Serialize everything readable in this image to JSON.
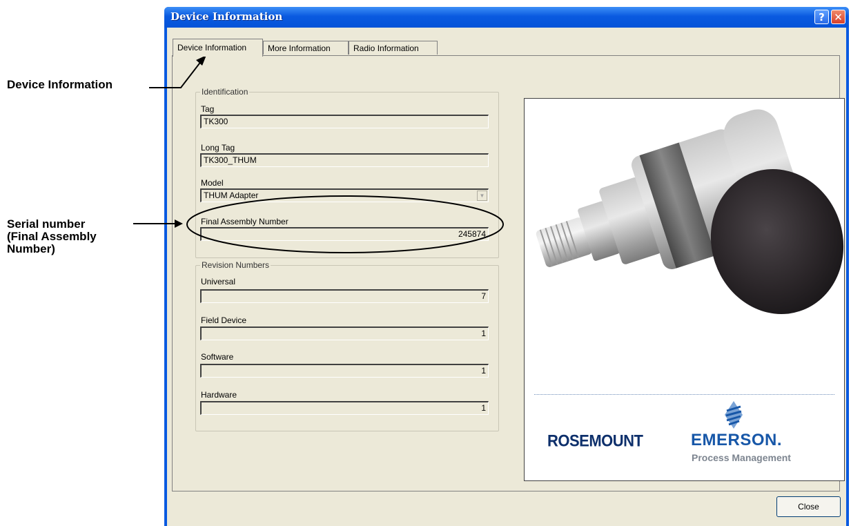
{
  "annotations": {
    "device_info_label": "Device Information",
    "serial_line1": "Serial number",
    "serial_line2": "(Final Assembly",
    "serial_line3": "Number)"
  },
  "window": {
    "title": "Device Information",
    "help_glyph": "?",
    "close_glyph": "✕"
  },
  "tabs": [
    {
      "label": "Device Information",
      "active": true
    },
    {
      "label": "More Information",
      "active": false
    },
    {
      "label": "Radio Information",
      "active": false
    }
  ],
  "identification": {
    "group_label": "Identification",
    "tag_label": "Tag",
    "tag_value": "TK300",
    "long_tag_label": "Long Tag",
    "long_tag_value": "TK300_THUM",
    "model_label": "Model",
    "model_value": "THUM Adapter",
    "final_assembly_label": "Final Assembly Number",
    "final_assembly_value": "245874"
  },
  "revision": {
    "group_label": "Revision Numbers",
    "universal_label": "Universal",
    "universal_value": "7",
    "field_device_label": "Field Device",
    "field_device_value": "1",
    "software_label": "Software",
    "software_value": "1",
    "hardware_label": "Hardware",
    "hardware_value": "1"
  },
  "branding": {
    "rosemount": "ROSEMOUNT",
    "emerson": "EMERSON.",
    "process_management": "Process Management"
  },
  "buttons": {
    "close": "Close"
  },
  "colors": {
    "title_bar": "#0a5ae0",
    "dialog_bg": "#ece9d8",
    "emerson_blue": "#1757a8",
    "rosemount_navy": "#0d2f6b"
  }
}
